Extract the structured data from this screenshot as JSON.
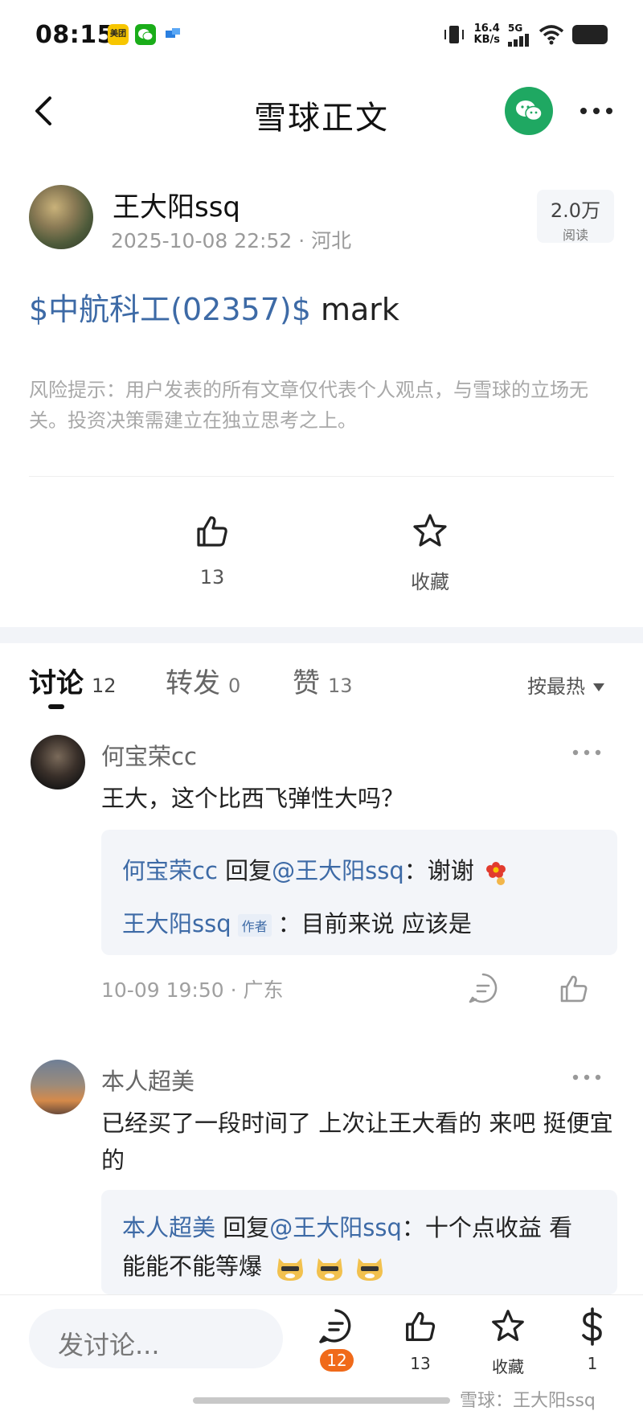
{
  "status_bar": {
    "time": "08:15",
    "net_speed": "16.4",
    "net_unit": "KB/s",
    "network": "5G",
    "meituan_label": "美团",
    "icons": [
      "meituan-app-icon",
      "wechat-app-icon",
      "blue-app-icon",
      "vibrate-icon",
      "signal-icon",
      "wifi-icon",
      "battery-icon"
    ]
  },
  "nav": {
    "title": "雪球正文",
    "back_icon": "back-arrow-icon",
    "share_icon": "wechat-icon",
    "more_icon": "more-icon"
  },
  "author": {
    "name": "王大阳ssq",
    "meta": "2025-10-08 22:52 · 河北",
    "read_count": "2.0万",
    "read_label": "阅读"
  },
  "post": {
    "stock": "$中航科工(02357)$",
    "text": " mark",
    "risk": "风险提示：用户发表的所有文章仅代表个人观点，与雪球的立场无关。投资决策需建立在独立思考之上。"
  },
  "actions": {
    "like_count": "13",
    "favorite_label": "收藏"
  },
  "tabs": [
    {
      "label": "讨论",
      "count": "12"
    },
    {
      "label": "转发",
      "count": "0"
    },
    {
      "label": "赞",
      "count": "13"
    }
  ],
  "sort_label": "按最热",
  "comments": [
    {
      "user": "何宝荣cc",
      "text": "王大，这个比西飞弹性大吗？",
      "replies": [
        {
          "user": "何宝荣cc",
          "mid": " 回复",
          "mention": "@王大阳ssq",
          "content": "：谢谢"
        },
        {
          "user": "王大阳ssq",
          "tag": "作者",
          "content": "：目前来说 应该是"
        }
      ],
      "time": "10-09 19:50 · 广东"
    },
    {
      "user": "本人超美",
      "text": "已经买了一段时间了 上次让王大看的 来吧 挺便宜的",
      "replies": [
        {
          "user": "本人超美",
          "mid": " 回复",
          "mention": "@王大阳ssq",
          "content": "：十个点收益 看",
          "content2": "能能不能等爆"
        }
      ]
    }
  ],
  "bottom_bar": {
    "input_placeholder": "发讨论...",
    "comment_count": "12",
    "like_count": "13",
    "favorite_label": "收藏",
    "reward_count": "1",
    "watermark": "雪球：王大阳ssq"
  },
  "colors": {
    "link_blue": "#3d6aa6",
    "wechat_green": "#1fa862",
    "badge_orange": "#f06a1a"
  }
}
